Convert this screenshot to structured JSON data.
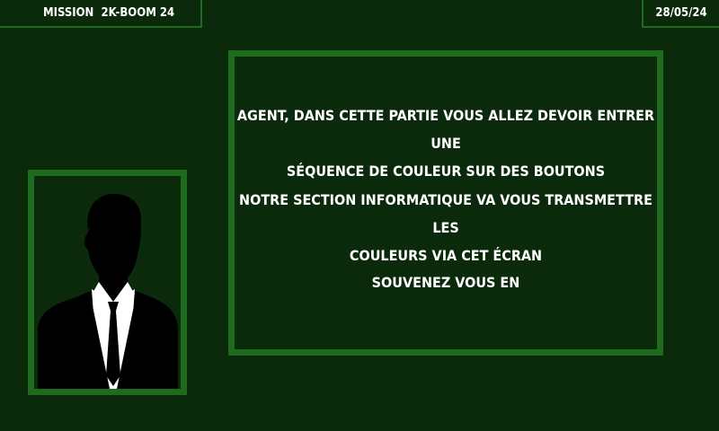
{
  "header": {
    "mission_label": "MISSION  2K-BOOM 24",
    "date": "28/05/24"
  },
  "message": {
    "line1": "AGENT, DANS CETTE PARTIE VOUS ALLEZ DEVOIR ENTRER UNE",
    "line2": "SÉQUENCE DE COULEUR SUR DES BOUTONS",
    "line3": "NOTRE SECTION INFORMATIQUE VA VOUS TRANSMETTRE LES",
    "line4": "COULEURS VIA CET ÉCRAN",
    "line5": "SOUVENEZ VOUS EN"
  },
  "portrait": {
    "icon": "agent-silhouette-icon"
  },
  "colors": {
    "background": "#0b2a0b",
    "frame": "#1e6b1e",
    "text": "#ffffff"
  }
}
